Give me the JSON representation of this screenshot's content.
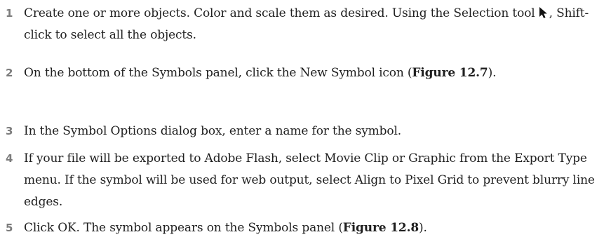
{
  "steps": [
    {
      "number": "1",
      "text_before_icon": "Create one or more objects. Color and scale them as desired. Using the Selection tool",
      "icon": "selection-tool-arrow-icon",
      "text_after_icon": ", Shift-click to select all the objects."
    },
    {
      "number": "2",
      "text_before": "On the bottom of the Symbols panel, click the New Symbol icon (",
      "figure": "Figure 12.7",
      "text_after": ")."
    },
    {
      "number": "3",
      "text": "In the Symbol Options dialog box, enter a name for the symbol."
    },
    {
      "number": "4",
      "text": "If your file will be exported to Adobe Flash, select Movie Clip or Graphic from the Export Type menu. If the symbol will be used for web output, select Align to Pixel Grid to prevent blurry line edges."
    },
    {
      "number": "5",
      "text_before": "Click OK. The symbol appears on the Symbols panel (",
      "figure": "Figure 12.8",
      "text_after": ")."
    }
  ],
  "colors": {
    "step_number": "#7c7c7c",
    "body_text": "#1f1f1f"
  }
}
